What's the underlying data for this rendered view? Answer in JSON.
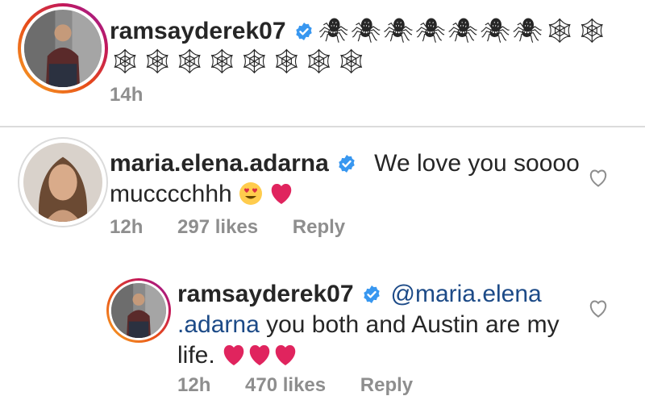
{
  "comments": [
    {
      "username": "ramsayderek07",
      "text_line1": "🕷🕷🕷🕷🕷🕷🕷🕸🕸",
      "text_line2": "🕸🕸🕸🕸🕸🕸🕸🕸",
      "time": "14h"
    },
    {
      "username": "maria.elena.adarna",
      "text_line1": "We love you soooo",
      "text_line2": "mucccchhh",
      "time": "12h",
      "likes": "297 likes",
      "reply": "Reply"
    },
    {
      "username": "ramsayderek07",
      "mention_part1": "@maria.elena",
      "mention_part2": ".adarna",
      "text_after_mention": "you both and Austin are my",
      "text_line3": "life.",
      "time": "12h",
      "likes": "470 likes",
      "reply": "Reply"
    }
  ],
  "colors": {
    "verified": "#3897f0",
    "heart": "#e0245e",
    "mention": "#1c4a87",
    "meta": "#8e8e8e"
  }
}
